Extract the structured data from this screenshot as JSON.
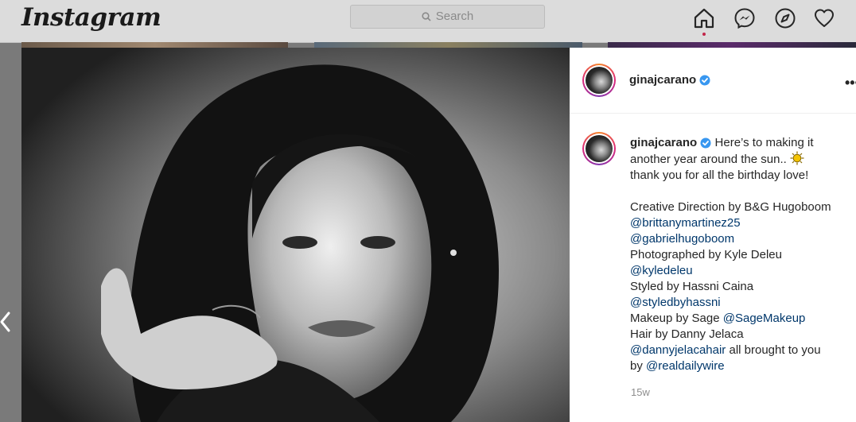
{
  "app": {
    "logo": "Instagram"
  },
  "search": {
    "placeholder": "Search"
  },
  "nav": {
    "icons": [
      "home-icon",
      "messenger-icon",
      "explore-icon",
      "heart-icon"
    ]
  },
  "post": {
    "username": "ginajcarano",
    "time": "15w",
    "caption": {
      "intro_1": "Here’s to making it",
      "intro_2": "another year around the sun..",
      "intro_3": "thank you for all the birthday love!",
      "creative": "Creative Direction by B&G Hugoboom",
      "m1": "@brittanymartinez25",
      "m2": "@gabrielhugoboom",
      "photo": "Photographed by Kyle Deleu",
      "m3": "@kyledeleu",
      "styled": "Styled by Hassni Caina",
      "m4": "@styledbyhassni",
      "makeup": "Makeup by Sage",
      "m5": "@SageMakeup",
      "hair": "Hair by Danny Jelaca",
      "m6": "@dannyjelacahair",
      "brought": "all brought to you",
      "by": "by",
      "m7": "@realdailywire"
    }
  },
  "colors": {
    "link": "#00376b",
    "verified": "#3897f0",
    "badge": "#c2264a"
  }
}
